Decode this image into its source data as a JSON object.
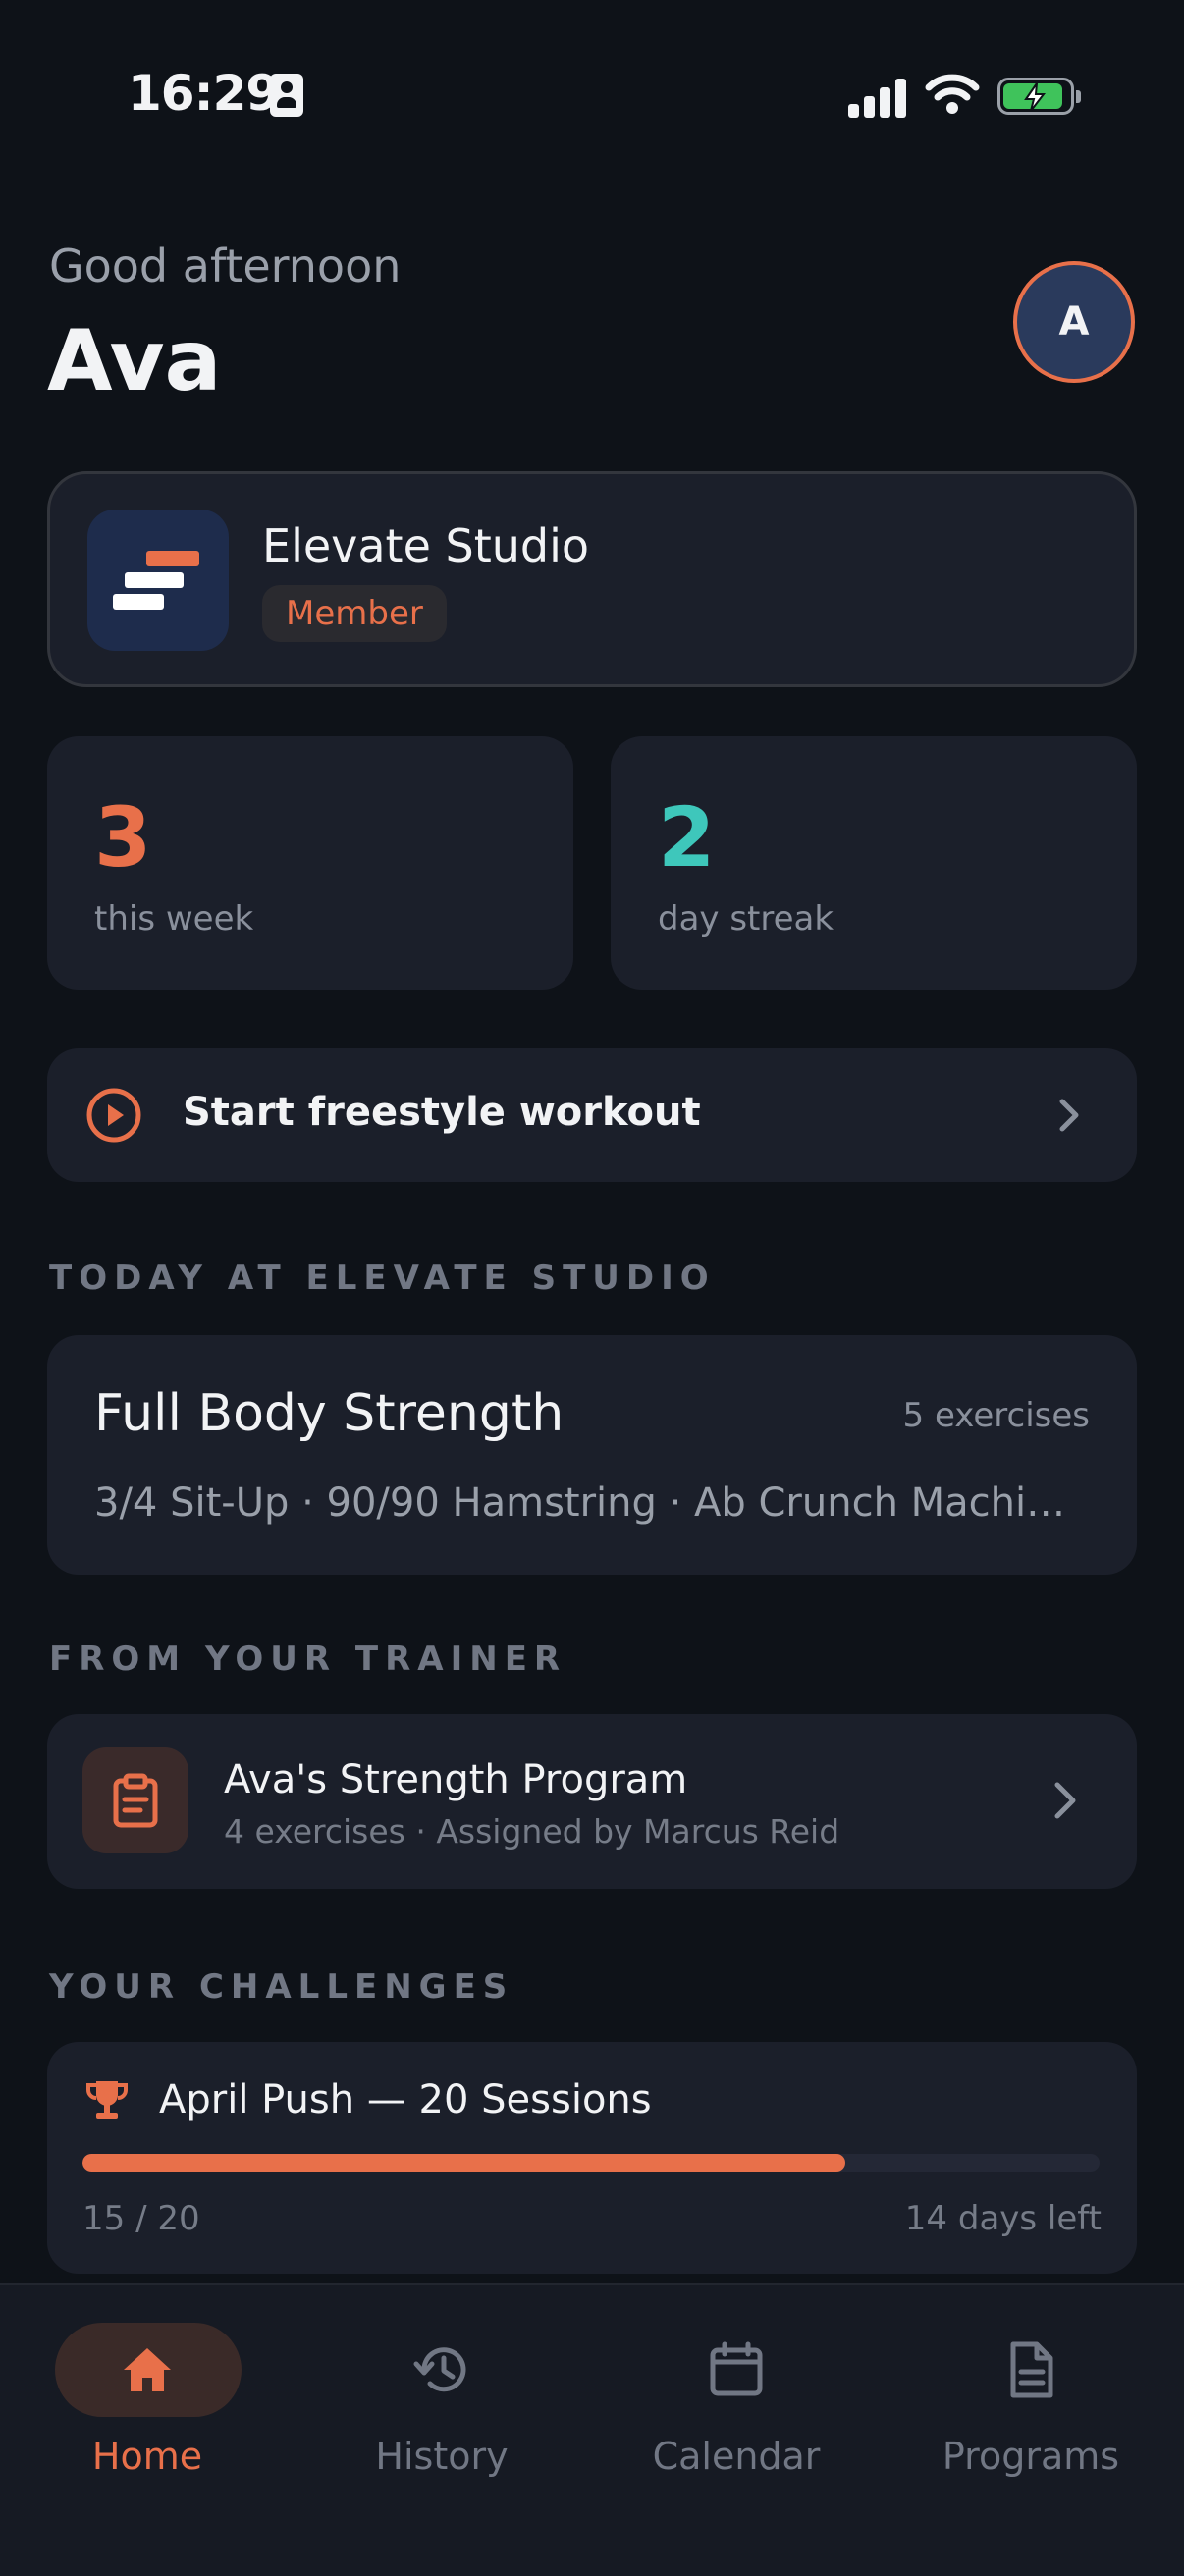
{
  "status_bar": {
    "time": "16:29"
  },
  "header": {
    "greeting": "Good afternoon",
    "name": "Ava",
    "avatar_initial": "A"
  },
  "studio": {
    "name": "Elevate Studio",
    "badge": "Member"
  },
  "stats": [
    {
      "value": "3",
      "label": "this week",
      "color": "#e8704a"
    },
    {
      "value": "2",
      "label": "day streak",
      "color": "#3ec7bb"
    }
  ],
  "freestyle": {
    "label": "Start freestyle workout"
  },
  "sections": {
    "today": "TODAY AT ELEVATE STUDIO",
    "trainer": "FROM YOUR TRAINER",
    "challenges": "YOUR CHALLENGES"
  },
  "workout": {
    "title": "Full Body Strength",
    "count": "5 exercises",
    "exercises": "3/4 Sit-Up · 90/90 Hamstring · Ab Crunch Machine · …"
  },
  "program": {
    "title": "Ava's Strength Program",
    "subtitle": "4 exercises · Assigned by Marcus Reid"
  },
  "challenge": {
    "title": "April Push — 20 Sessions",
    "progress_text": "15 / 20",
    "progress_fraction": 0.75,
    "days_left": "14 days left"
  },
  "tabs": [
    {
      "label": "Home",
      "icon": "home-icon",
      "active": true
    },
    {
      "label": "History",
      "icon": "history-icon",
      "active": false
    },
    {
      "label": "Calendar",
      "icon": "calendar-icon",
      "active": false
    },
    {
      "label": "Programs",
      "icon": "document-icon",
      "active": false
    }
  ],
  "colors": {
    "accent": "#e8704a",
    "teal": "#3ec7bb",
    "background": "#0e1218",
    "card": "#1b1f2a"
  }
}
